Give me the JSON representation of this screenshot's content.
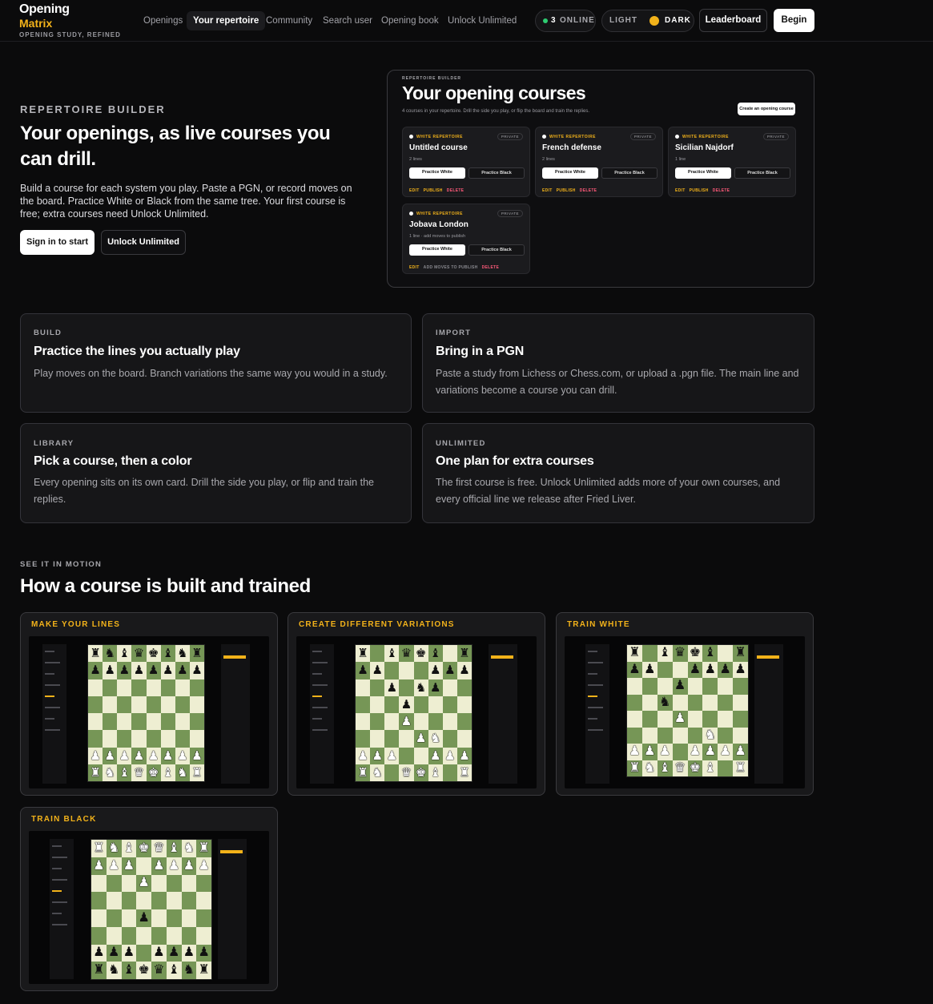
{
  "brand": {
    "line1": "Opening",
    "line2": "Matrix",
    "tagline": "OPENING STUDY, REFINED"
  },
  "nav": [
    "Openings",
    "Your repertoire",
    "Community",
    "Search user",
    "Opening book",
    "Unlock Unlimited"
  ],
  "status": {
    "online_count": "3",
    "online_label": "ONLINE"
  },
  "theme": {
    "light": "LIGHT",
    "dark": "DARK"
  },
  "header_actions": {
    "leaderboard": "Leaderboard",
    "begin": "Begin"
  },
  "hero": {
    "eyebrow": "REPERTOIRE BUILDER",
    "title": "Your openings, as live courses you can drill.",
    "body": "Build a course for each system you play. Paste a PGN, or record moves on the board. Practice White or Black from the same tree. Your first course is free; extra courses need Unlock Unlimited.",
    "signin": "Sign in to start",
    "unlock": "Unlock Unlimited"
  },
  "preview": {
    "eyebrow": "REPERTOIRE BUILDER",
    "title": "Your opening courses",
    "subtitle": "4 courses in your repertoire. Drill the side you play, or flip the board and train the replies.",
    "create": "Create an opening course",
    "courses": [
      {
        "tag": "WHITE REPERTOIRE",
        "badge": "PRIVATE",
        "title": "Untitled course",
        "meta": "2 lines",
        "practice_white": "Practice White",
        "practice_black": "Practice Black",
        "actions": [
          "EDIT",
          "PUBLISH",
          "DELETE"
        ]
      },
      {
        "tag": "WHITE REPERTOIRE",
        "badge": "PRIVATE",
        "title": "French defense",
        "meta": "2 lines",
        "practice_white": "Practice White",
        "practice_black": "Practice Black",
        "actions": [
          "EDIT",
          "PUBLISH",
          "DELETE"
        ]
      },
      {
        "tag": "WHITE REPERTOIRE",
        "badge": "PRIVATE",
        "title": "Sicilian Najdorf",
        "meta": "1 line",
        "practice_white": "Practice White",
        "practice_black": "Practice Black",
        "actions": [
          "EDIT",
          "PUBLISH",
          "DELETE"
        ]
      },
      {
        "tag": "WHITE REPERTOIRE",
        "badge": "PRIVATE",
        "title": "Jobava London",
        "meta": "1 line · add moves to publish",
        "practice_white": "Practice White",
        "practice_black": "Practice Black",
        "actions": [
          "EDIT",
          "ADD MOVES TO PUBLISH",
          "DELETE"
        ]
      }
    ]
  },
  "features": [
    {
      "eyebrow": "BUILD",
      "title": "Practice the lines you actually play",
      "body": "Play moves on the board. Branch variations the same way you would in a study."
    },
    {
      "eyebrow": "IMPORT",
      "title": "Bring in a PGN",
      "body": "Paste a study from Lichess or Chess.com, or upload a .pgn file. The main line and variations become a course you can drill."
    },
    {
      "eyebrow": "LIBRARY",
      "title": "Pick a course, then a color",
      "body": "Every opening sits on its own card. Drill the side you play, or flip and train the replies."
    },
    {
      "eyebrow": "UNLIMITED",
      "title": "One plan for extra courses",
      "body": "The first course is free. Unlock Unlimited adds more of your own courses, and every official line we release after Fried Liver."
    }
  ],
  "motion": {
    "eyebrow": "SEE IT IN MOTION",
    "title": "How a course is built and trained",
    "clips": [
      {
        "label": "MAKE YOUR LINES",
        "board": [
          "rnbqkbnr",
          "pppppppp",
          "........",
          "........",
          "........",
          "........",
          "PPPPPPPP",
          "RNBQKBNR"
        ]
      },
      {
        "label": "CREATE DIFFERENT VARIATIONS",
        "board": [
          "r.bqkb.r",
          "pp...ppp",
          "..p.np..",
          "...p....",
          "...P....",
          "....PN..",
          "PPP..PPP",
          "RN.QKB.R"
        ]
      },
      {
        "label": "TRAIN WHITE",
        "board": [
          "r.bqkb.r",
          "pp..pppp",
          "...p....",
          "..n.....",
          "...P....",
          ".....N..",
          "PPP.PPPP",
          "RNBQKB.R"
        ]
      },
      {
        "label": "TRAIN BLACK",
        "board": [
          "RNBKQBNR",
          "PPP.PPPP",
          "...P....",
          "........",
          "...p....",
          "........",
          "ppp.pppp",
          "rnbkqbnr"
        ]
      }
    ]
  },
  "colors": {
    "accent": "#f2b21a",
    "online": "#2ecc71",
    "danger": "#ff5a7a",
    "light_square": "#eeeed2",
    "dark_square": "#769656"
  }
}
